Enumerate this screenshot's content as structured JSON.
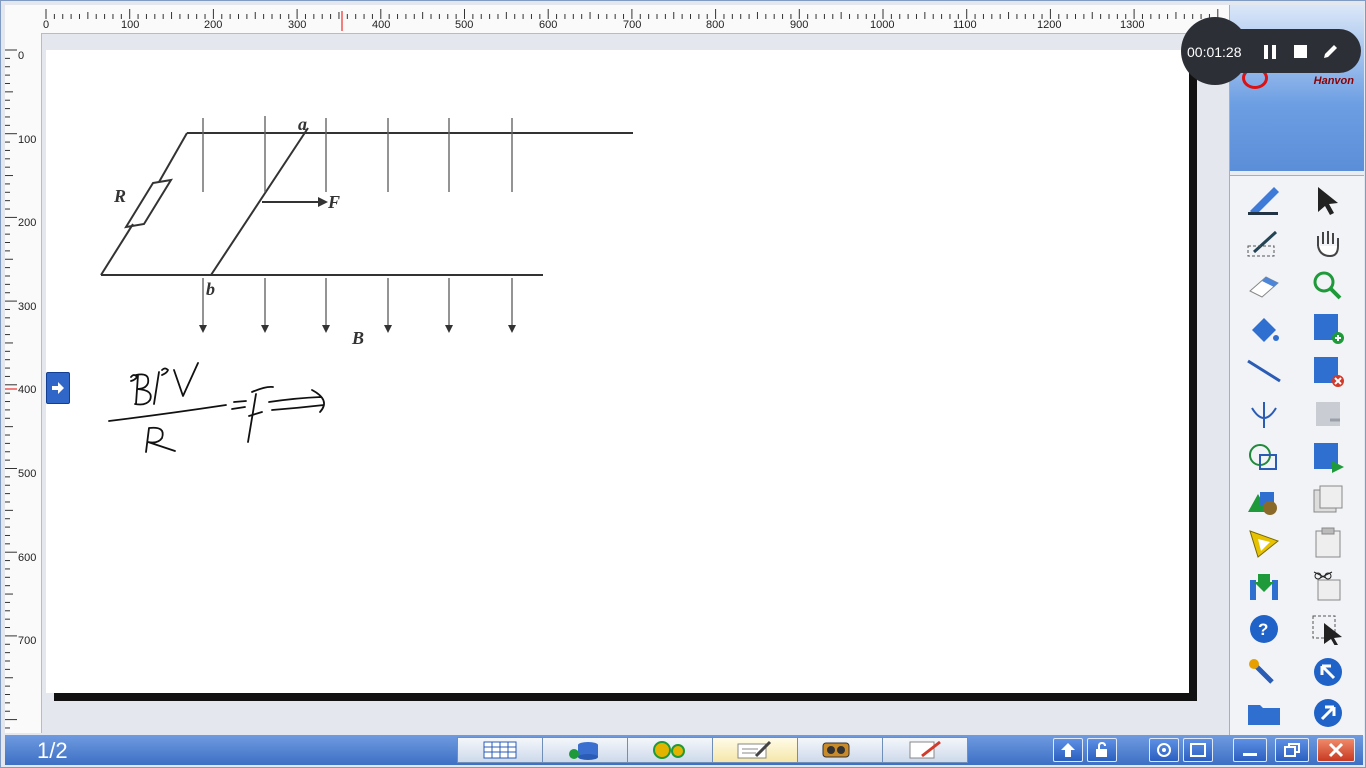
{
  "recorder": {
    "time": "00:01:28"
  },
  "logo": {
    "brand": "Hanvon"
  },
  "ruler": {
    "top_labels": [
      "0",
      "100",
      "200",
      "300",
      "400",
      "500",
      "600",
      "700",
      "800",
      "900",
      "1000",
      "1100",
      "1200",
      "1300"
    ],
    "left_labels": [
      "0",
      "100",
      "200",
      "300",
      "400",
      "500",
      "600",
      "700"
    ]
  },
  "diagram": {
    "label_R": "R",
    "label_a": "a",
    "label_b": "b",
    "label_F": "F",
    "label_B": "B"
  },
  "taskbar": {
    "page_indicator": "1/2"
  },
  "colors": {
    "titlebar": "#3d6fc4",
    "accent_red": "#d23b2b"
  }
}
